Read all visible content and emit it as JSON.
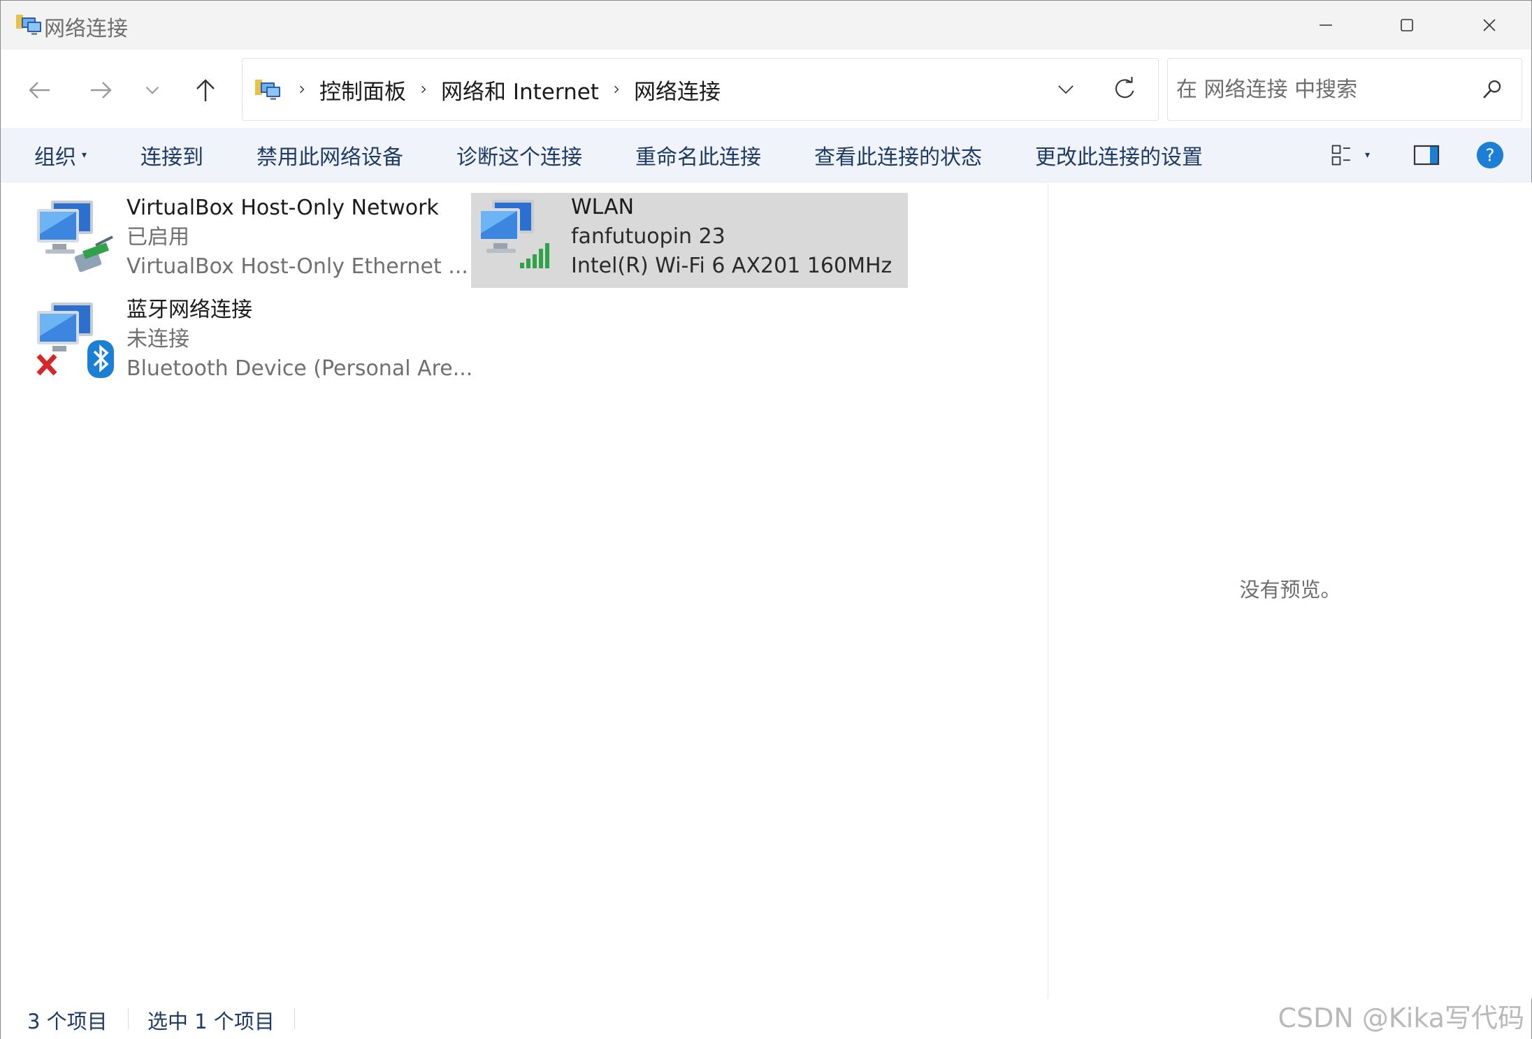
{
  "window": {
    "title": "网络连接"
  },
  "nav": {
    "breadcrumbs": [
      "控制面板",
      "网络和 Internet",
      "网络连接"
    ],
    "search_placeholder": "在 网络连接 中搜索"
  },
  "commands": {
    "organize": "组织",
    "connect_to": "连接到",
    "disable": "禁用此网络设备",
    "diagnose": "诊断这个连接",
    "rename": "重命名此连接",
    "view_status": "查看此连接的状态",
    "change_settings": "更改此连接的设置"
  },
  "connections": [
    {
      "name": "VirtualBox Host-Only Network",
      "status": "已启用",
      "device": "VirtualBox Host-Only Ethernet ..."
    },
    {
      "name": "WLAN",
      "status": "fanfutuopin 23",
      "device": "Intel(R) Wi-Fi 6 AX201 160MHz"
    },
    {
      "name": "蓝牙网络连接",
      "status": "未连接",
      "device": "Bluetooth Device (Personal Are..."
    }
  ],
  "preview": {
    "text": "没有预览。"
  },
  "statusbar": {
    "count": "3 个项目",
    "selected": "选中 1 个项目"
  },
  "watermark": "CSDN @Kika写代码",
  "colors": {
    "accent": "#1e3a66",
    "selection": "#d9d9d9",
    "help": "#1c7fd6"
  }
}
